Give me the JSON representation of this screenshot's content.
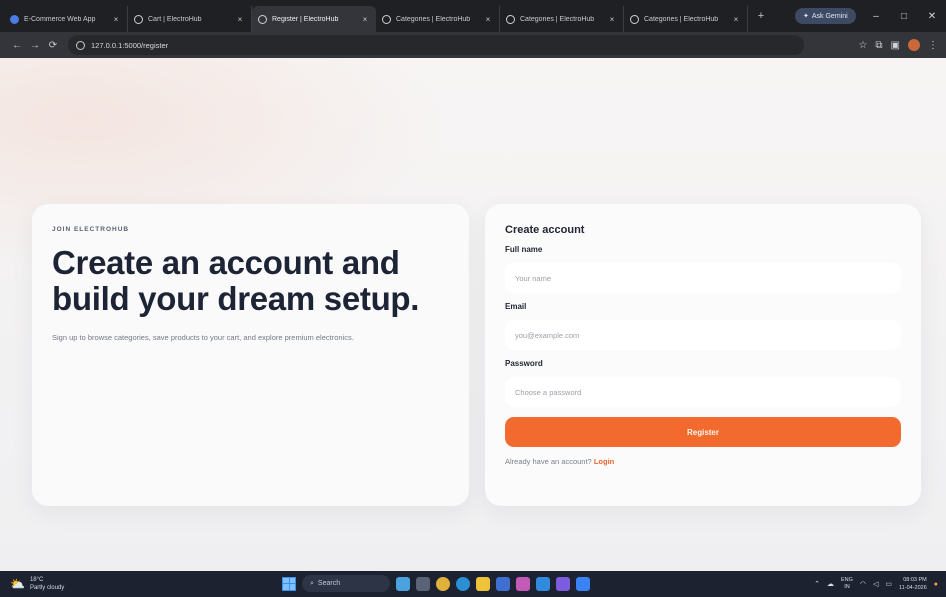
{
  "browser": {
    "tabs": [
      {
        "title": "E-Commerce Web App",
        "active": false,
        "app_icon": true
      },
      {
        "title": "Cart | ElectroHub",
        "active": false,
        "app_icon": false
      },
      {
        "title": "Register | ElectroHub",
        "active": true,
        "app_icon": false
      },
      {
        "title": "Categories | ElectroHub",
        "active": false,
        "app_icon": false
      },
      {
        "title": "Categories | ElectroHub",
        "active": false,
        "app_icon": false
      },
      {
        "title": "Categories | ElectroHub",
        "active": false,
        "app_icon": false
      }
    ],
    "tab_close_glyph": "×",
    "new_tab_glyph": "+",
    "gemini_label": "Ask Gemini",
    "url": "127.0.0.1:5000/register",
    "window_controls": {
      "minimize": "–",
      "restore": "□",
      "close": "✕"
    }
  },
  "hero": {
    "eyebrow": "JOIN ELECTROHUB",
    "title": "Create an account and build your dream setup.",
    "description": "Sign up to browse categories, save products to your cart, and explore premium electronics."
  },
  "form": {
    "heading": "Create account",
    "full_name": {
      "label": "Full name",
      "placeholder": "Your name",
      "value": ""
    },
    "email": {
      "label": "Email",
      "placeholder": "you@example.com",
      "value": ""
    },
    "password": {
      "label": "Password",
      "placeholder": "Choose a password",
      "value": ""
    },
    "submit_label": "Register",
    "login_prompt": "Already have an account?",
    "login_link": "Login"
  },
  "taskbar": {
    "weather_temp": "18°C",
    "weather_desc": "Partly cloudy",
    "search_label": "Search",
    "lang_top": "ENG",
    "lang_bottom": "IN",
    "time": "08:03 PM",
    "date": "11-04-2026"
  },
  "colors": {
    "accent": "#f26a2e",
    "heading": "#1d2436",
    "chrome_dark": "#1f2024"
  }
}
